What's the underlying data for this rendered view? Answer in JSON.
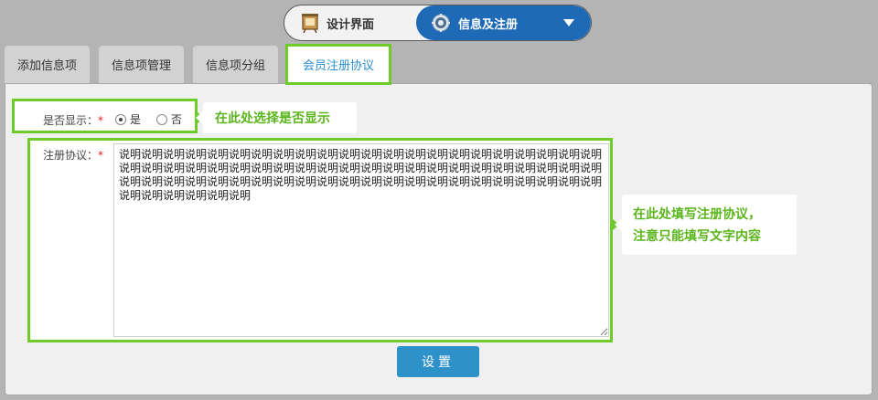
{
  "switcher": {
    "design_label": "设计界面",
    "info_label": "信息及注册",
    "colors": {
      "active_bg": "#1f6ab6",
      "inactive_bg": "#f2f2f2"
    }
  },
  "tabs": [
    {
      "label": "添加信息项",
      "active": false
    },
    {
      "label": "信息项管理",
      "active": false
    },
    {
      "label": "信息项分组",
      "active": false
    },
    {
      "label": "会员注册协议",
      "active": true
    }
  ],
  "form": {
    "show_label": "是否显示：",
    "required_mark": "*",
    "radio_options": [
      {
        "label": "是",
        "checked": true
      },
      {
        "label": "否",
        "checked": false
      }
    ],
    "agreement_label": "注册协议：",
    "agreement_text": "说明说明说明说明说明说明说明说明说明说明说明说明说明说明说明说明说明说明说明说明说明说明说明说明说明说明说明说明说明说明说明说明说明说明说明说明说明说明说明说明说明说明说明说明说明说明说明说明说明说明说明说明说明说明说明说明说明说明说明说明说明说明说明说明说明说明说明说明说明说明说明说明",
    "submit_label": "设置"
  },
  "callouts": {
    "show_hint": "在此处选择是否显示",
    "agreement_hint_line1": "在此处填写注册协议，",
    "agreement_hint_line2": "注意只能填写文字内容",
    "highlight_color": "#6fcb2a"
  }
}
